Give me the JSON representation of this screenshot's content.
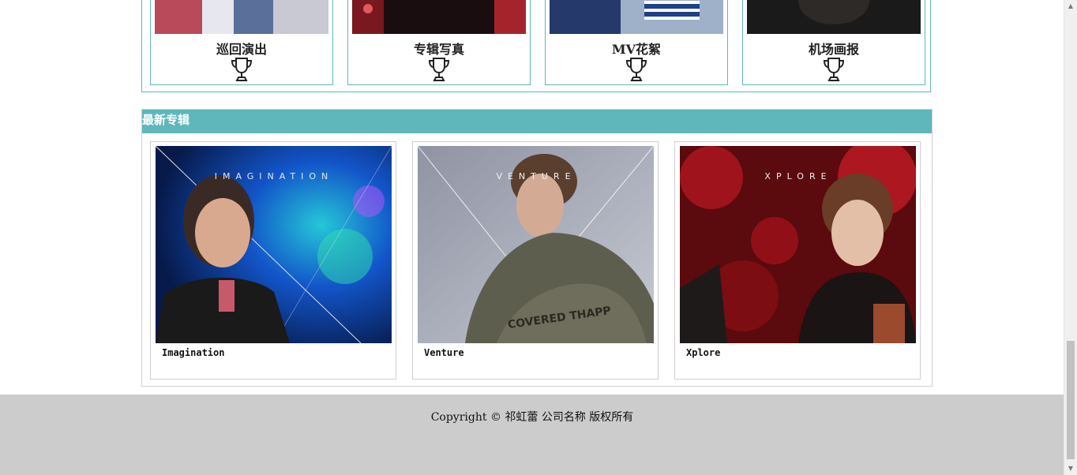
{
  "categories": [
    {
      "label": "巡回演出",
      "icon": "trophy-icon"
    },
    {
      "label": "专辑写真",
      "icon": "trophy-icon"
    },
    {
      "label": "MV花絮",
      "icon": "trophy-icon"
    },
    {
      "label": "机场画报",
      "icon": "trophy-icon"
    }
  ],
  "albums": {
    "title": "最新专辑",
    "items": [
      {
        "name": "Imagination",
        "cover_text": "IMAGINATION"
      },
      {
        "name": "Venture",
        "cover_text": "VENTURE"
      },
      {
        "name": "Xplore",
        "cover_text": "XPLORE"
      }
    ]
  },
  "footer": {
    "copyright": "Copyright © 祁虹蕾 公司名称 版权所有"
  },
  "colors": {
    "accent": "#5fb7bc",
    "footer_bg": "#cccccc"
  }
}
